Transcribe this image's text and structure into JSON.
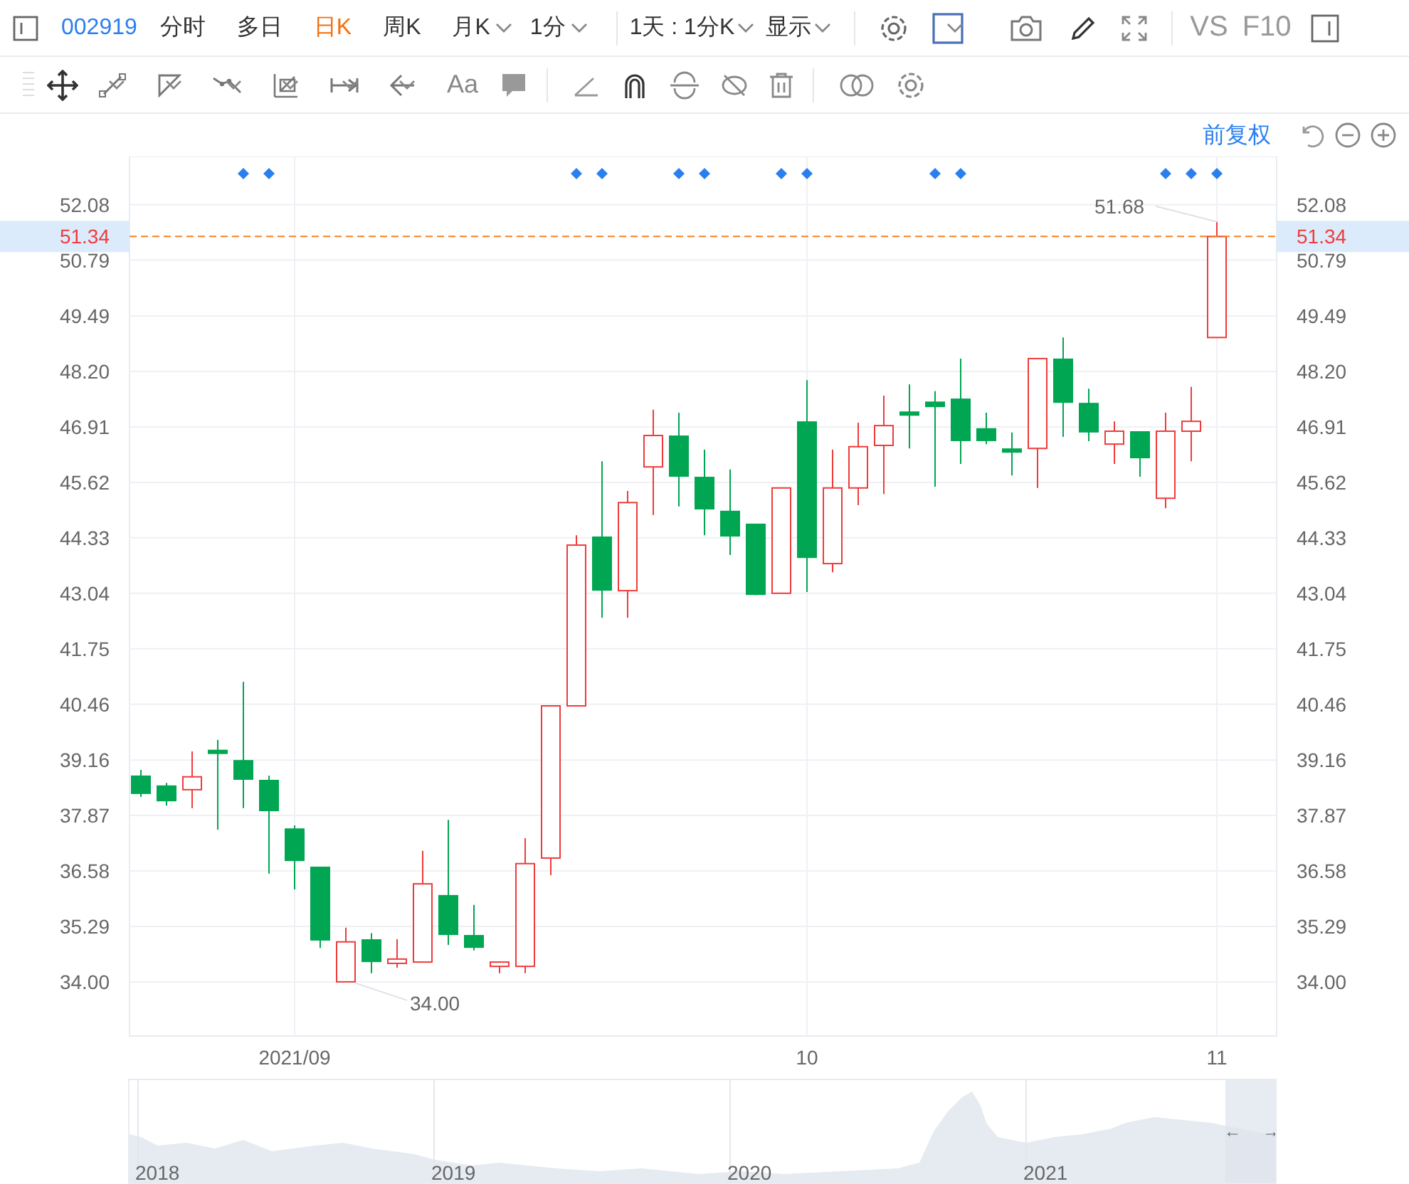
{
  "toolbar": {
    "code": "002919",
    "periods": [
      {
        "label": "分时",
        "selected": false,
        "dropdown": false
      },
      {
        "label": "多日",
        "selected": false,
        "dropdown": false
      },
      {
        "label": "日K",
        "selected": true,
        "dropdown": false
      },
      {
        "label": "周K",
        "selected": false,
        "dropdown": false
      },
      {
        "label": "月K",
        "selected": false,
        "dropdown": true
      },
      {
        "label": "1分",
        "selected": false,
        "dropdown": true
      }
    ],
    "range_select": "1天 : 1分K",
    "display_menu": "显示",
    "compare": "VS",
    "f10": "F10"
  },
  "drawing_toolbar": {
    "text_tool": "Aa"
  },
  "adjust_mode": "前复权",
  "chart": {
    "price_line": {
      "right_label": "51.34"
    },
    "right_axis_labels": [
      "52.08",
      "50.79",
      "49.49",
      "48.20",
      "46.91",
      "45.62",
      "44.33",
      "43.04",
      "41.75",
      "40.46",
      "39.16",
      "37.87",
      "36.58",
      "35.29",
      "34.00"
    ],
    "event_flags": [
      false,
      false,
      false,
      false,
      true,
      true,
      false,
      false,
      false,
      false,
      false,
      false,
      false,
      false,
      false,
      false,
      false,
      true,
      true,
      false,
      false,
      true,
      true,
      false,
      false,
      true,
      true,
      false,
      false,
      false,
      false,
      true,
      true,
      false,
      false,
      false,
      false,
      false,
      false,
      false,
      true,
      true,
      true
    ],
    "chart_data": {
      "type": "candlestick",
      "grid": true,
      "ylim": [
        32.74,
        53.2
      ],
      "categories": [
        null,
        null,
        null,
        null,
        null,
        null,
        "2021/09",
        null,
        null,
        null,
        null,
        null,
        null,
        null,
        null,
        null,
        null,
        null,
        null,
        null,
        null,
        null,
        null,
        null,
        null,
        null,
        "10",
        null,
        null,
        null,
        null,
        null,
        null,
        null,
        null,
        null,
        null,
        null,
        null,
        null,
        null,
        null,
        "11"
      ],
      "yticks": [
        {
          "value": 52.08,
          "label": "52.08"
        },
        {
          "value": 50.79,
          "label": "50.79"
        },
        {
          "value": 49.49,
          "label": "49.49"
        },
        {
          "value": 48.2,
          "label": "48.20"
        },
        {
          "value": 46.91,
          "label": "46.91"
        },
        {
          "value": 45.62,
          "label": "45.62"
        },
        {
          "value": 44.33,
          "label": "44.33"
        },
        {
          "value": 43.04,
          "label": "43.04"
        },
        {
          "value": 41.75,
          "label": "41.75"
        },
        {
          "value": 40.46,
          "label": "40.46"
        },
        {
          "value": 39.16,
          "label": "39.16"
        },
        {
          "value": 37.87,
          "label": "37.87"
        },
        {
          "value": 36.58,
          "label": "36.58"
        },
        {
          "value": 35.29,
          "label": "35.29"
        },
        {
          "value": 34.0,
          "label": "34.00"
        }
      ],
      "ohlc": [
        [
          38.8,
          38.93,
          38.3,
          38.37
        ],
        [
          38.57,
          38.63,
          38.1,
          38.2
        ],
        [
          38.47,
          39.36,
          38.04,
          38.77
        ],
        [
          39.4,
          39.63,
          37.54,
          39.3
        ],
        [
          39.16,
          40.98,
          38.04,
          38.7
        ],
        [
          38.7,
          38.8,
          36.52,
          37.97
        ],
        [
          37.57,
          37.64,
          36.15,
          36.81
        ],
        [
          36.68,
          36.68,
          34.79,
          34.96
        ],
        [
          34.0,
          35.26,
          34.0,
          34.93
        ],
        [
          34.99,
          35.13,
          34.2,
          34.46
        ],
        [
          34.43,
          34.99,
          34.33,
          34.53
        ],
        [
          34.46,
          37.05,
          34.46,
          36.28
        ],
        [
          36.02,
          37.77,
          34.86,
          35.09
        ],
        [
          35.09,
          35.79,
          34.73,
          34.79
        ],
        [
          34.36,
          34.46,
          34.2,
          34.46
        ],
        [
          34.36,
          37.34,
          34.2,
          36.75
        ],
        [
          36.88,
          40.42,
          36.48,
          40.42
        ],
        [
          40.42,
          44.39,
          40.42,
          44.16
        ],
        [
          44.36,
          46.11,
          42.47,
          43.1
        ],
        [
          43.1,
          45.42,
          42.47,
          45.15
        ],
        [
          45.98,
          47.31,
          44.86,
          46.71
        ],
        [
          46.71,
          47.24,
          45.06,
          45.75
        ],
        [
          45.75,
          46.38,
          44.39,
          44.99
        ],
        [
          44.96,
          45.92,
          43.93,
          44.36
        ],
        [
          44.66,
          44.66,
          43.0,
          43.0
        ],
        [
          43.04,
          45.49,
          43.04,
          45.49
        ],
        [
          47.04,
          48.0,
          43.07,
          43.86
        ],
        [
          43.73,
          46.38,
          43.53,
          45.49
        ],
        [
          45.49,
          47.01,
          45.09,
          46.45
        ],
        [
          46.48,
          47.64,
          45.35,
          46.94
        ],
        [
          47.27,
          47.9,
          46.41,
          47.17
        ],
        [
          47.5,
          47.74,
          45.52,
          47.37
        ],
        [
          47.57,
          48.5,
          46.05,
          46.58
        ],
        [
          46.88,
          47.24,
          46.51,
          46.58
        ],
        [
          46.41,
          46.78,
          45.78,
          46.31
        ],
        [
          46.41,
          48.5,
          45.49,
          48.5
        ],
        [
          48.5,
          48.99,
          46.68,
          47.47
        ],
        [
          47.47,
          47.8,
          46.58,
          46.78
        ],
        [
          46.51,
          47.04,
          46.05,
          46.81
        ],
        [
          46.81,
          46.81,
          45.75,
          46.18
        ],
        [
          45.25,
          47.24,
          45.02,
          46.81
        ],
        [
          46.81,
          47.84,
          46.11,
          47.04
        ],
        [
          48.99,
          51.68,
          48.99,
          51.34
        ]
      ],
      "ref_lines": [
        {
          "axis": "y",
          "value": 51.34,
          "color": "#f5821f",
          "label": "51.34"
        }
      ],
      "annotations": [
        "51.68",
        "34.00"
      ]
    }
  },
  "navigator": {
    "years": [
      "2018",
      "2019",
      "2020",
      "2021"
    ],
    "arrows": [
      "←",
      "→"
    ]
  }
}
